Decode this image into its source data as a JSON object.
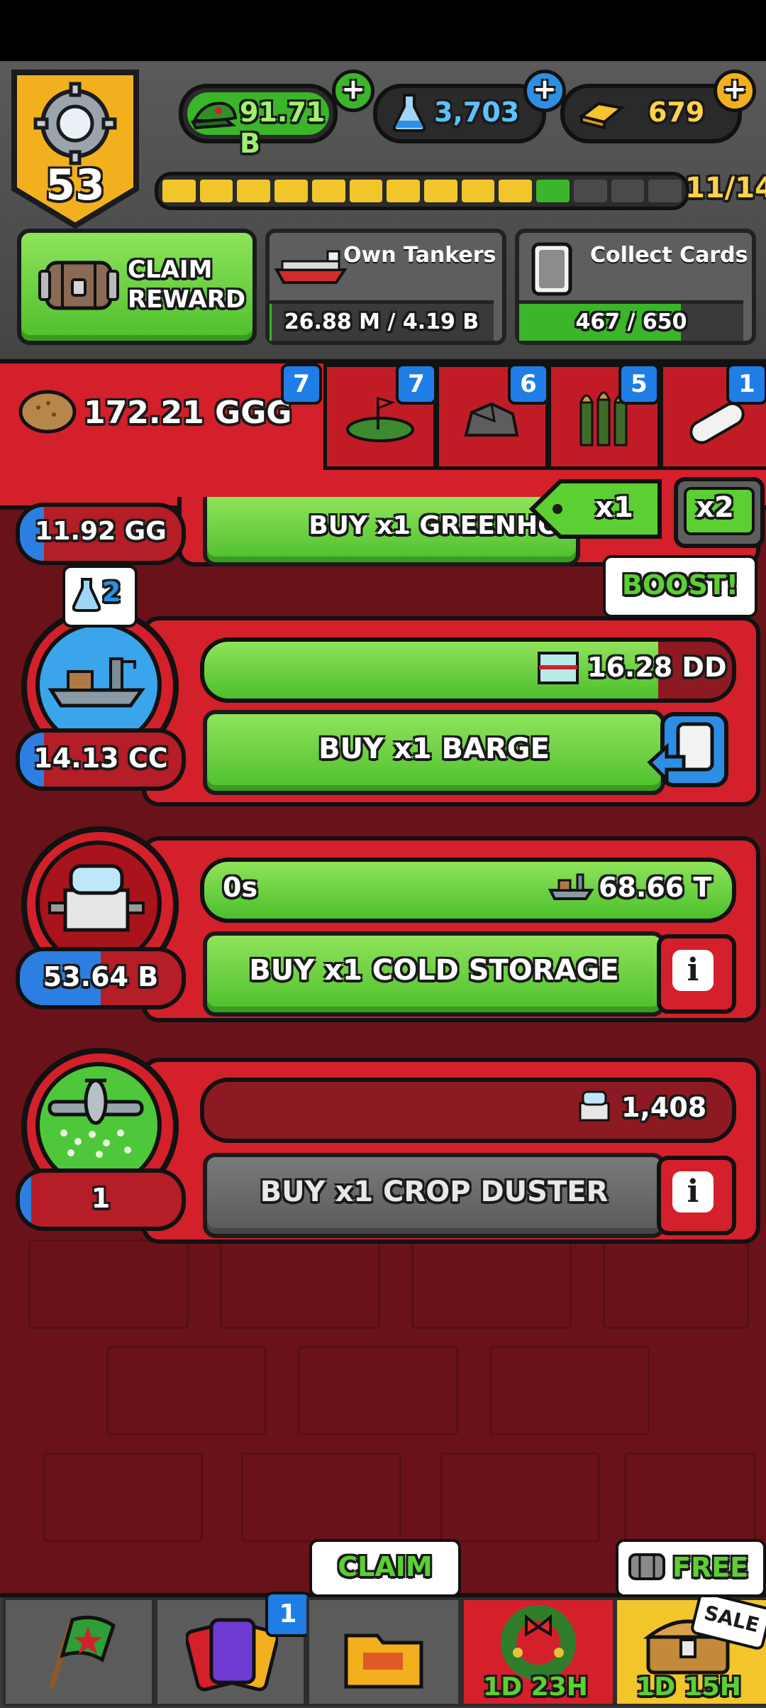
{
  "level": "53",
  "currencies": {
    "cash": "91.71 B",
    "research": "3,703",
    "gold": "679"
  },
  "progress": {
    "label": "11/14",
    "segments_total": 14,
    "segments_filled": 11
  },
  "claim_reward": {
    "line1": "CLAIM",
    "line2": "REWARD"
  },
  "own_tankers": {
    "title": "Own Tankers",
    "progress": "26.88 M / 4.19 B",
    "fraction": 0.01
  },
  "collect_cards": {
    "title": "Collect Cards",
    "progress": "467 / 650",
    "fraction": 0.72
  },
  "resource": {
    "value": "172.21 GGG"
  },
  "tabs": [
    {
      "badge": "7",
      "icon": "none"
    },
    {
      "badge": "7",
      "icon": "island-flag-icon"
    },
    {
      "badge": "6",
      "icon": "rock-icon"
    },
    {
      "badge": "5",
      "icon": "bullets-icon"
    },
    {
      "badge": "1",
      "icon": "pill-icon"
    }
  ],
  "multiplier": {
    "label": "x1",
    "boost_label": "x2",
    "boost_text": "BOOST!"
  },
  "greenhouse": {
    "price": "11.92 GG",
    "buy_label": "BUY x1 GREENHO",
    "price_fill": 0.15
  },
  "barge": {
    "badge": "2",
    "price": "14.13 CC",
    "price_fill": 0.15,
    "output": "16.28 DD",
    "bar_fill": 0.86,
    "buy_label": "BUY x1 BARGE"
  },
  "cold_storage": {
    "price": "53.64 B",
    "price_fill": 0.5,
    "timer": "0s",
    "output": "68.66 T",
    "bar_fill": 1.0,
    "buy_label": "BUY x1 COLD STORAGE"
  },
  "crop_duster": {
    "price": "1",
    "price_fill": 0.07,
    "output": "1,408",
    "bar_fill": 0.0,
    "buy_label": "BUY x1 CROP DUSTER"
  },
  "bottom_nav": {
    "cards_badge": "1",
    "claim_label": "CLAIM",
    "event_timer": "1D 23H",
    "free_label": "FREE",
    "sale_label": "SALE",
    "shop_timer": "1D 15H"
  }
}
